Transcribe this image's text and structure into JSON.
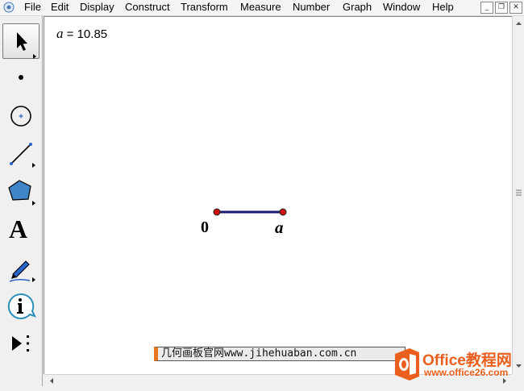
{
  "menu": [
    "File",
    "Edit",
    "Display",
    "Construct",
    "Transform",
    "Measure",
    "Number",
    "Graph",
    "Window",
    "Help"
  ],
  "window_buttons": {
    "minimize": "_",
    "restore": "❐",
    "close": "✕"
  },
  "toolbox": [
    "arrow-select-tool",
    "point-tool",
    "compass-tool",
    "straightedge-tool",
    "polygon-tool",
    "text-tool",
    "marker-tool",
    "information-tool",
    "custom-tools"
  ],
  "text_tool_glyph": "A",
  "measurement": {
    "var": "a",
    "eq": " = 10.85"
  },
  "segment": {
    "left_label": "0",
    "right_label": "a",
    "color": "#1a1a6e",
    "point_color": "#cc1111"
  },
  "banner": "几何画板官网www.jihehuaban.com.cn",
  "logo": {
    "title": "Office教程网",
    "url": "www.office26.com",
    "accent": "#eb5f1e"
  }
}
